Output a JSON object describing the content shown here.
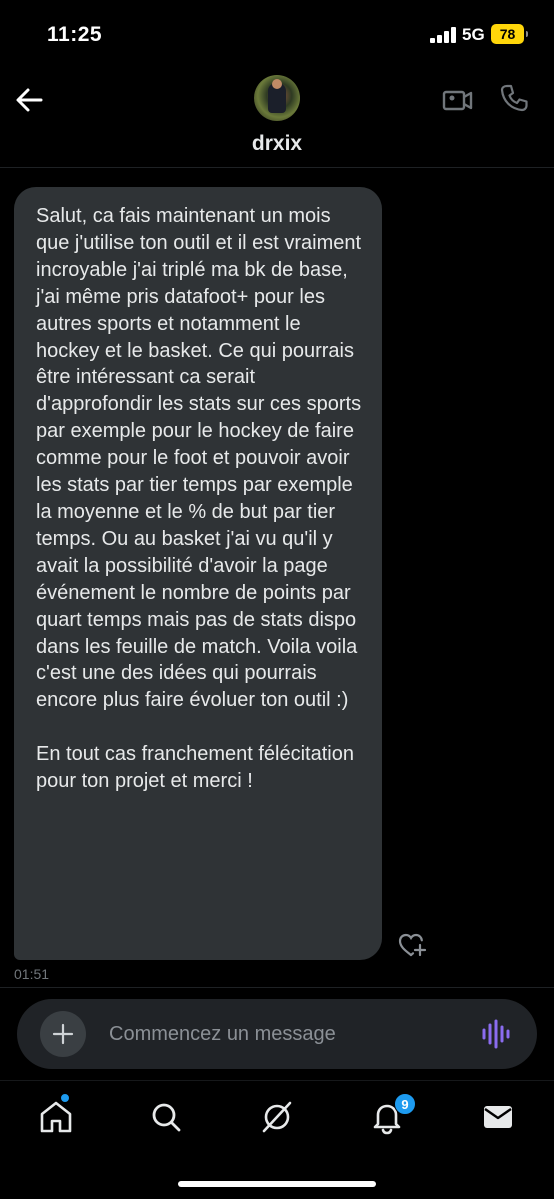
{
  "status_bar": {
    "time": "11:25",
    "network": "5G",
    "battery": "78",
    "battery_color": "#ffd60a"
  },
  "header": {
    "back_icon": "arrow-left-icon",
    "username": "drxix",
    "video_icon": "video-camera-icon",
    "call_icon": "phone-icon"
  },
  "conversation": {
    "message_text": "Salut, ca fais maintenant un mois que j'utilise ton outil et il est vraiment incroyable j'ai triplé ma bk de base, j'ai même pris datafoot+ pour les autres sports et notamment le hockey et le basket. Ce qui pourrais être intéressant ca serait d'approfondir les stats sur ces sports par exemple pour le hockey de faire comme pour le foot et pouvoir avoir les stats par tier temps par exemple la moyenne et le % de but par tier temps. Ou au basket j'ai vu qu'il y avait la possibilité d'avoir la page événement le nombre de points par quart temps mais pas de stats dispo dans les feuille de match. Voila voila c'est une des idées qui pourrais encore plus faire évoluer ton outil :)\n\nEn tout cas franchement félécitation pour ton projet et merci !",
    "message_time": "01:51",
    "reaction_icon": "heart-plus-icon",
    "bubble_color": "#2f3336"
  },
  "composer": {
    "placeholder": "Commencez un message",
    "add_icon": "plus-icon",
    "voice_icon": "voice-wave-icon",
    "voice_color": "#8b6cf0"
  },
  "bottom_nav": {
    "items": [
      "home-icon",
      "search-icon",
      "grok-icon",
      "bell-icon",
      "mail-icon"
    ],
    "notification_count": "9",
    "accent_color": "#1d9bf0"
  }
}
